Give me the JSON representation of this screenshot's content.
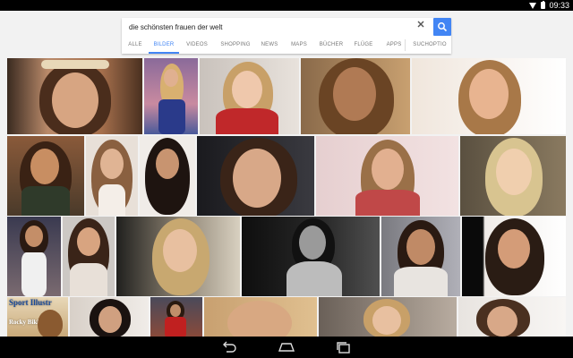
{
  "status_bar": {
    "time": "09:33",
    "wifi_icon": "wifi-icon",
    "battery_icon": "battery-icon"
  },
  "search": {
    "query": "die schönsten frauen der welt",
    "clear_icon": "close-icon",
    "search_icon": "search-icon",
    "accent": "#4285f4"
  },
  "tabs": [
    {
      "label": "ALLE",
      "active": false
    },
    {
      "label": "BILDER",
      "active": true
    },
    {
      "label": "VIDEOS",
      "active": false
    },
    {
      "label": "SHOPPING",
      "active": false
    },
    {
      "label": "NEWS",
      "active": false
    },
    {
      "label": "MAPS",
      "active": false
    },
    {
      "label": "BÜCHER",
      "active": false
    },
    {
      "label": "FLÜGE",
      "active": false
    },
    {
      "label": "APPS",
      "active": false
    },
    {
      "label": "SUCHOPTIO",
      "active": false
    }
  ],
  "results": {
    "magazine_text": "Sport Illustr",
    "magazine_subtext": "Rocky Bikini"
  },
  "nav_bar": {
    "back_icon": "back-icon",
    "home_icon": "home-icon",
    "recents_icon": "recents-icon"
  }
}
